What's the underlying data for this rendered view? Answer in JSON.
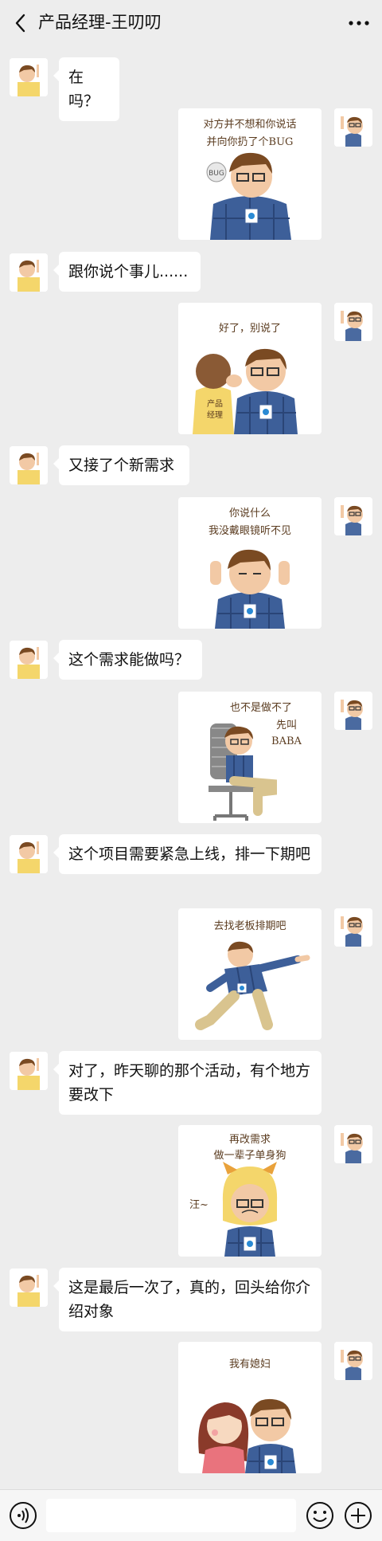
{
  "header": {
    "title": "产品经理-王叨叨"
  },
  "messages": {
    "m1": "在吗？",
    "m2": "跟你说个事儿......",
    "m3": "又接了个新需求",
    "m4": "这个需求能做吗？",
    "m5": "这个项目需要紧急上线，排一下期吧",
    "m6": "对了，昨天聊的那个活动，有个地方要改下",
    "m7": "这是最后一次了，真的，回头给你介绍对象"
  },
  "stickers": {
    "s1a": "对方并不想和你说话",
    "s1b": "并向你扔了个BUG",
    "s1c": "BUG",
    "s2a": "好了，别说了",
    "s2b": "产品",
    "s2c": "经理",
    "s3a": "你说什么",
    "s3b": "我没戴眼镜听不见",
    "s4a": "也不是做不了",
    "s4b": "先叫",
    "s4c": "BABA",
    "s5a": "去找老板排期吧",
    "s6a": "再改需求",
    "s6b": "做一辈子单身狗",
    "s6c": "汪~",
    "s7a": "我有媳妇"
  },
  "colors": {
    "accent": "#07c160",
    "background": "#ededed",
    "bubble": "#ffffff"
  }
}
